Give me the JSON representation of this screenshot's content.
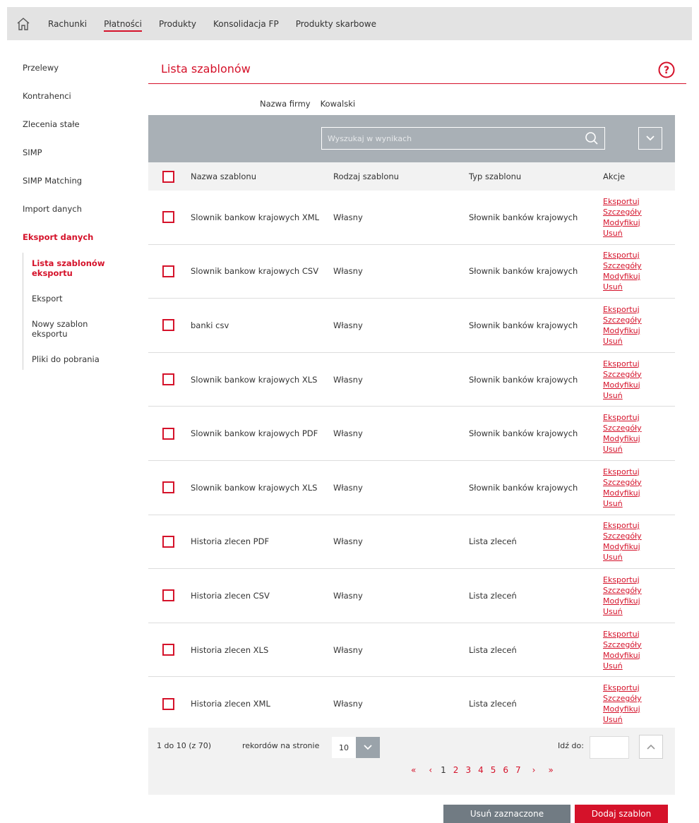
{
  "nav": {
    "items": [
      {
        "label": "Rachunki",
        "active": false
      },
      {
        "label": "Płatności",
        "active": true
      },
      {
        "label": "Produkty",
        "active": false
      },
      {
        "label": "Konsolidacja FP",
        "active": false
      },
      {
        "label": "Produkty skarbowe",
        "active": false
      }
    ]
  },
  "sidebar": {
    "items": [
      "Przelewy",
      "Kontrahenci",
      "Zlecenia stałe",
      "SIMP",
      "SIMP Matching",
      "Import danych",
      "Eksport danych"
    ],
    "sub": [
      "Lista szablonów eksportu",
      "Eksport",
      "Nowy szablon eksportu",
      "Pliki do pobrania"
    ]
  },
  "page": {
    "title": "Lista szablonów",
    "company_label": "Nazwa firmy",
    "company_value": "Kowalski"
  },
  "search": {
    "placeholder": "Wyszukaj w wynikach"
  },
  "table": {
    "headers": [
      "Nazwa szablonu",
      "Rodzaj szablonu",
      "Typ szablonu",
      "Akcje"
    ],
    "actions": [
      "Eksportuj",
      "Szczegóły",
      "Modyfikuj",
      "Usuń"
    ],
    "rows": [
      {
        "name": "Slownik bankow krajowych XML",
        "kind": "Własny",
        "type": "Słownik banków krajowych"
      },
      {
        "name": "Slownik bankow krajowych CSV",
        "kind": "Własny",
        "type": "Słownik banków krajowych"
      },
      {
        "name": "banki csv",
        "kind": "Własny",
        "type": "Słownik banków krajowych"
      },
      {
        "name": "Slownik bankow krajowych XLS",
        "kind": "Własny",
        "type": "Słownik banków krajowych"
      },
      {
        "name": "Slownik bankow krajowych PDF",
        "kind": "Własny",
        "type": "Słownik banków krajowych"
      },
      {
        "name": "Slownik bankow krajowych XLS",
        "kind": "Własny",
        "type": "Słownik banków krajowych"
      },
      {
        "name": "Historia zlecen PDF",
        "kind": "Własny",
        "type": "Lista zleceń"
      },
      {
        "name": "Historia zlecen CSV",
        "kind": "Własny",
        "type": "Lista zleceń"
      },
      {
        "name": "Historia zlecen XLS",
        "kind": "Własny",
        "type": "Lista zleceń"
      },
      {
        "name": "Historia zlecen XML",
        "kind": "Własny",
        "type": "Lista zleceń"
      }
    ]
  },
  "footer": {
    "range": "1 do 10 (z 70)",
    "per_page_label": "rekordów na stronie",
    "per_page_value": "10",
    "goto_label": "Idź do:",
    "pager": {
      "first": "«",
      "prev": "‹",
      "pages": [
        "1",
        "2",
        "3",
        "4",
        "5",
        "6",
        "7"
      ],
      "current": "1",
      "next": "›",
      "last": "»"
    }
  },
  "buttons": {
    "delete_selected": "Usuń zaznaczone",
    "add_template": "Dodaj szablon"
  },
  "colors": {
    "accent": "#d5122a",
    "bar": "#a9b0b6",
    "grey_button": "#717b83"
  }
}
